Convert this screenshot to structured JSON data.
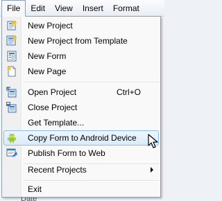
{
  "menubar": {
    "items": [
      "File",
      "Edit",
      "View",
      "Insert",
      "Format"
    ]
  },
  "file_menu": {
    "new_project": "New Project",
    "new_project_from_template": "New Project from Template",
    "new_form": "New Form",
    "new_page": "New Page",
    "open_project": "Open Project",
    "open_project_shortcut": "Ctrl+O",
    "close_project": "Close Project",
    "get_template": "Get Template...",
    "copy_form_to_android": "Copy Form to Android Device",
    "publish_form_to_web": "Publish Form to Web",
    "recent_projects": "Recent Projects",
    "exit": "Exit",
    "highlighted_item": "Copy Form to Android Device"
  },
  "background": {
    "partial_text": "Date"
  },
  "colors": {
    "highlight_border": "#8fbde8",
    "android_green": "#9fc43a"
  }
}
